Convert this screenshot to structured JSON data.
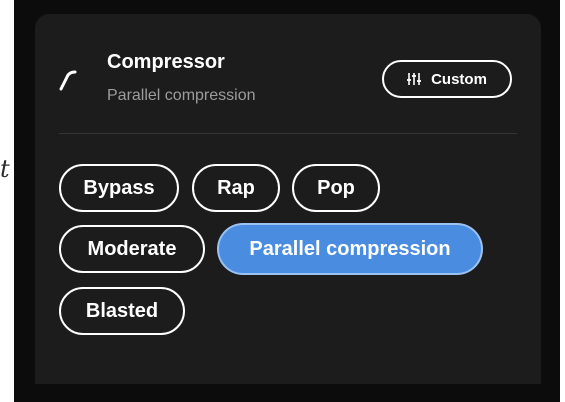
{
  "panel": {
    "title": "Compressor",
    "subtitle": "Parallel compression",
    "icon": "compressor-curve-icon"
  },
  "custom_button": {
    "label": "Custom",
    "icon": "sliders-icon"
  },
  "presets": [
    {
      "label": "Bypass",
      "selected": false
    },
    {
      "label": "Rap",
      "selected": false
    },
    {
      "label": "Pop",
      "selected": false
    },
    {
      "label": "Moderate",
      "selected": false
    },
    {
      "label": "Parallel compression",
      "selected": true
    },
    {
      "label": "Blasted",
      "selected": false
    }
  ],
  "colors": {
    "panel_bg": "#1c1c1c",
    "selected_chip": "#4a8ce0",
    "text_primary": "#ffffff",
    "text_secondary": "#9c9c9c"
  },
  "stray_text": "t"
}
